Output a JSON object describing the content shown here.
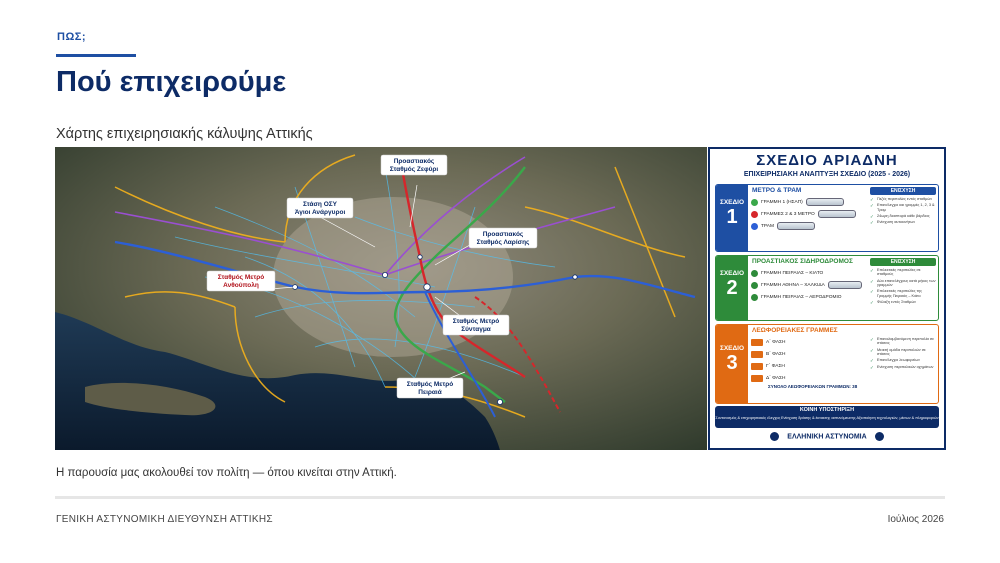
{
  "header": {
    "eyebrow": "ΠΩΣ;",
    "title": "Πού επιχειρούμε",
    "subtitle": "Χάρτης επιχειρησιακής κάλυψης Αττικής"
  },
  "map": {
    "labels": [
      {
        "id": "zefiri",
        "line1": "Προαστιακός",
        "line2": "Σταθμός Ζεφύρι",
        "accent": false
      },
      {
        "id": "oey",
        "line1": "Στάση ΟΣΥ",
        "line2": "Άγιοι Ανάργυροι",
        "accent": false
      },
      {
        "id": "larisis",
        "line1": "Προαστιακός",
        "line2": "Σταθμός Λαρίσης",
        "accent": false
      },
      {
        "id": "anthoupoli",
        "line1": "Σταθμός Μετρό",
        "line2": "Ανθούπολη",
        "accent": true
      },
      {
        "id": "syntagma",
        "line1": "Σταθμός Μετρό",
        "line2": "Σύνταγμα",
        "accent": false
      },
      {
        "id": "peiraias",
        "line1": "Σταθμός Μετρό",
        "line2": "Πειραιά",
        "accent": false
      }
    ],
    "colors": {
      "metro1": "#3aa84a",
      "metro2": "#d6262b",
      "metro3": "#2c5fd6",
      "tram": "#f5b21b",
      "rail": "#9a4fd1",
      "bus": "#4fc3f7"
    }
  },
  "plan": {
    "title": "ΣΧΕΔΙΟ ΑΡΙΑΔΝΗ",
    "subtitle": "ΕΠΙΧΕΙΡΗΣΙΑΚΗ ΑΝΑΠΤΥΞΗ ΣΧΕΔΙΟ (2025 - 2026)",
    "block_word": "ΣΧΕΔΙΟ",
    "blocks": [
      {
        "num": "1",
        "color": "#1e4fa3",
        "head": "ΜΕΤΡΟ & ΤΡΑΜ",
        "side_head": "ΕΝΙΣΧΥΣΗ",
        "rows": [
          "ΓΡΑΜΜΗ 1 (ΗΣΑΠ)",
          "ΓΡΑΜΜΕΣ 2 & 3 ΜΕΤΡΟ",
          "ΤΡΑΜ"
        ],
        "side": [
          "Πεζές περιπολίες εντός σταθμών",
          "Επανέλεγχοι και γραμμές 1, 2, 3 & Τραμ",
          "24ωρη διασπορά κάθε βάρδιας",
          "Ενίσχυση αυτοκινήτων"
        ]
      },
      {
        "num": "2",
        "color": "#2e8b3a",
        "head": "ΠΡΟΑΣΤΙΑΚΟΣ ΣΙΔΗΡΟΔΡΟΜΟΣ",
        "side_head": "ΕΝΙΣΧΥΣΗ",
        "rows": [
          "ΓΡΑΜΜΗ ΠΕΙΡΑΙΑΣ – ΚΙΑΤΟ",
          "ΓΡΑΜΜΗ ΑΘΗΝΑ – ΧΑΛΚΙΔΑ",
          "ΓΡΑΜΜΗ ΠΕΙΡΑΙΑΣ – ΑΕΡΟΔΡΟΜΙΟ"
        ],
        "side": [
          "Επιλεκτικές περιπολίες σε σταθμούς",
          "Δύο επανελέγχους κατά μήκος των γραμμών",
          "Επιλεκτικές περιπολίες της Γραμμής Πειραιάς – Κιάτο",
          "Φύλαξη εντός Σταθμών"
        ]
      },
      {
        "num": "3",
        "color": "#e06a13",
        "head": "ΛΕΩΦΟΡΕΙΑΚΕΣ ΓΡΑΜΜΕΣ",
        "side_head": "",
        "rows": [
          "Α΄ ΦΑΣΗ",
          "Β΄ ΦΑΣΗ",
          "Γ΄ ΦΑΣΗ",
          "Δ΄ ΦΑΣΗ"
        ],
        "side": [
          "Επαναλαμβανόμενη περιπολία σε στάσεις",
          "Μεικτή ομάδα περιπολιών σε στάσεις",
          "Επανέλεγχοι λεωφορείων",
          "Ενίσχυση περιπολικών οχημάτων"
        ],
        "total": "ΣΥΝΟΛΟ ΛΕΩΦΟΡΕΙΑΚΩΝ ΓΡΑΜΜΩΝ: 38"
      }
    ],
    "common": {
      "head": "ΚΟΙΝΗ ΥΠΟΣΤΗΡΙΞΗ",
      "items": [
        "Συντονισμός & επιχειρησιακός έλεγχος",
        "Ενίσχυση δράσης & έκτακτης αστυνόμευσης",
        "Αξιοποίηση τεχνολογιών, μέσων & πληροφοριών"
      ]
    },
    "footer": "ΕΛΛΗΝΙΚΗ ΑΣΤΥΝΟΜΙΑ"
  },
  "caption": "Η παρουσία μας ακολουθεί τον πολίτη — όπου κινείται στην Αττική.",
  "footer": {
    "left": "ΓΕΝΙΚΗ ΑΣΤΥΝΟΜΙΚΗ ΔΙΕΥΘΥΝΣΗ ΑΤΤΙΚΗΣ",
    "right": "Ιούλιος 2026"
  }
}
